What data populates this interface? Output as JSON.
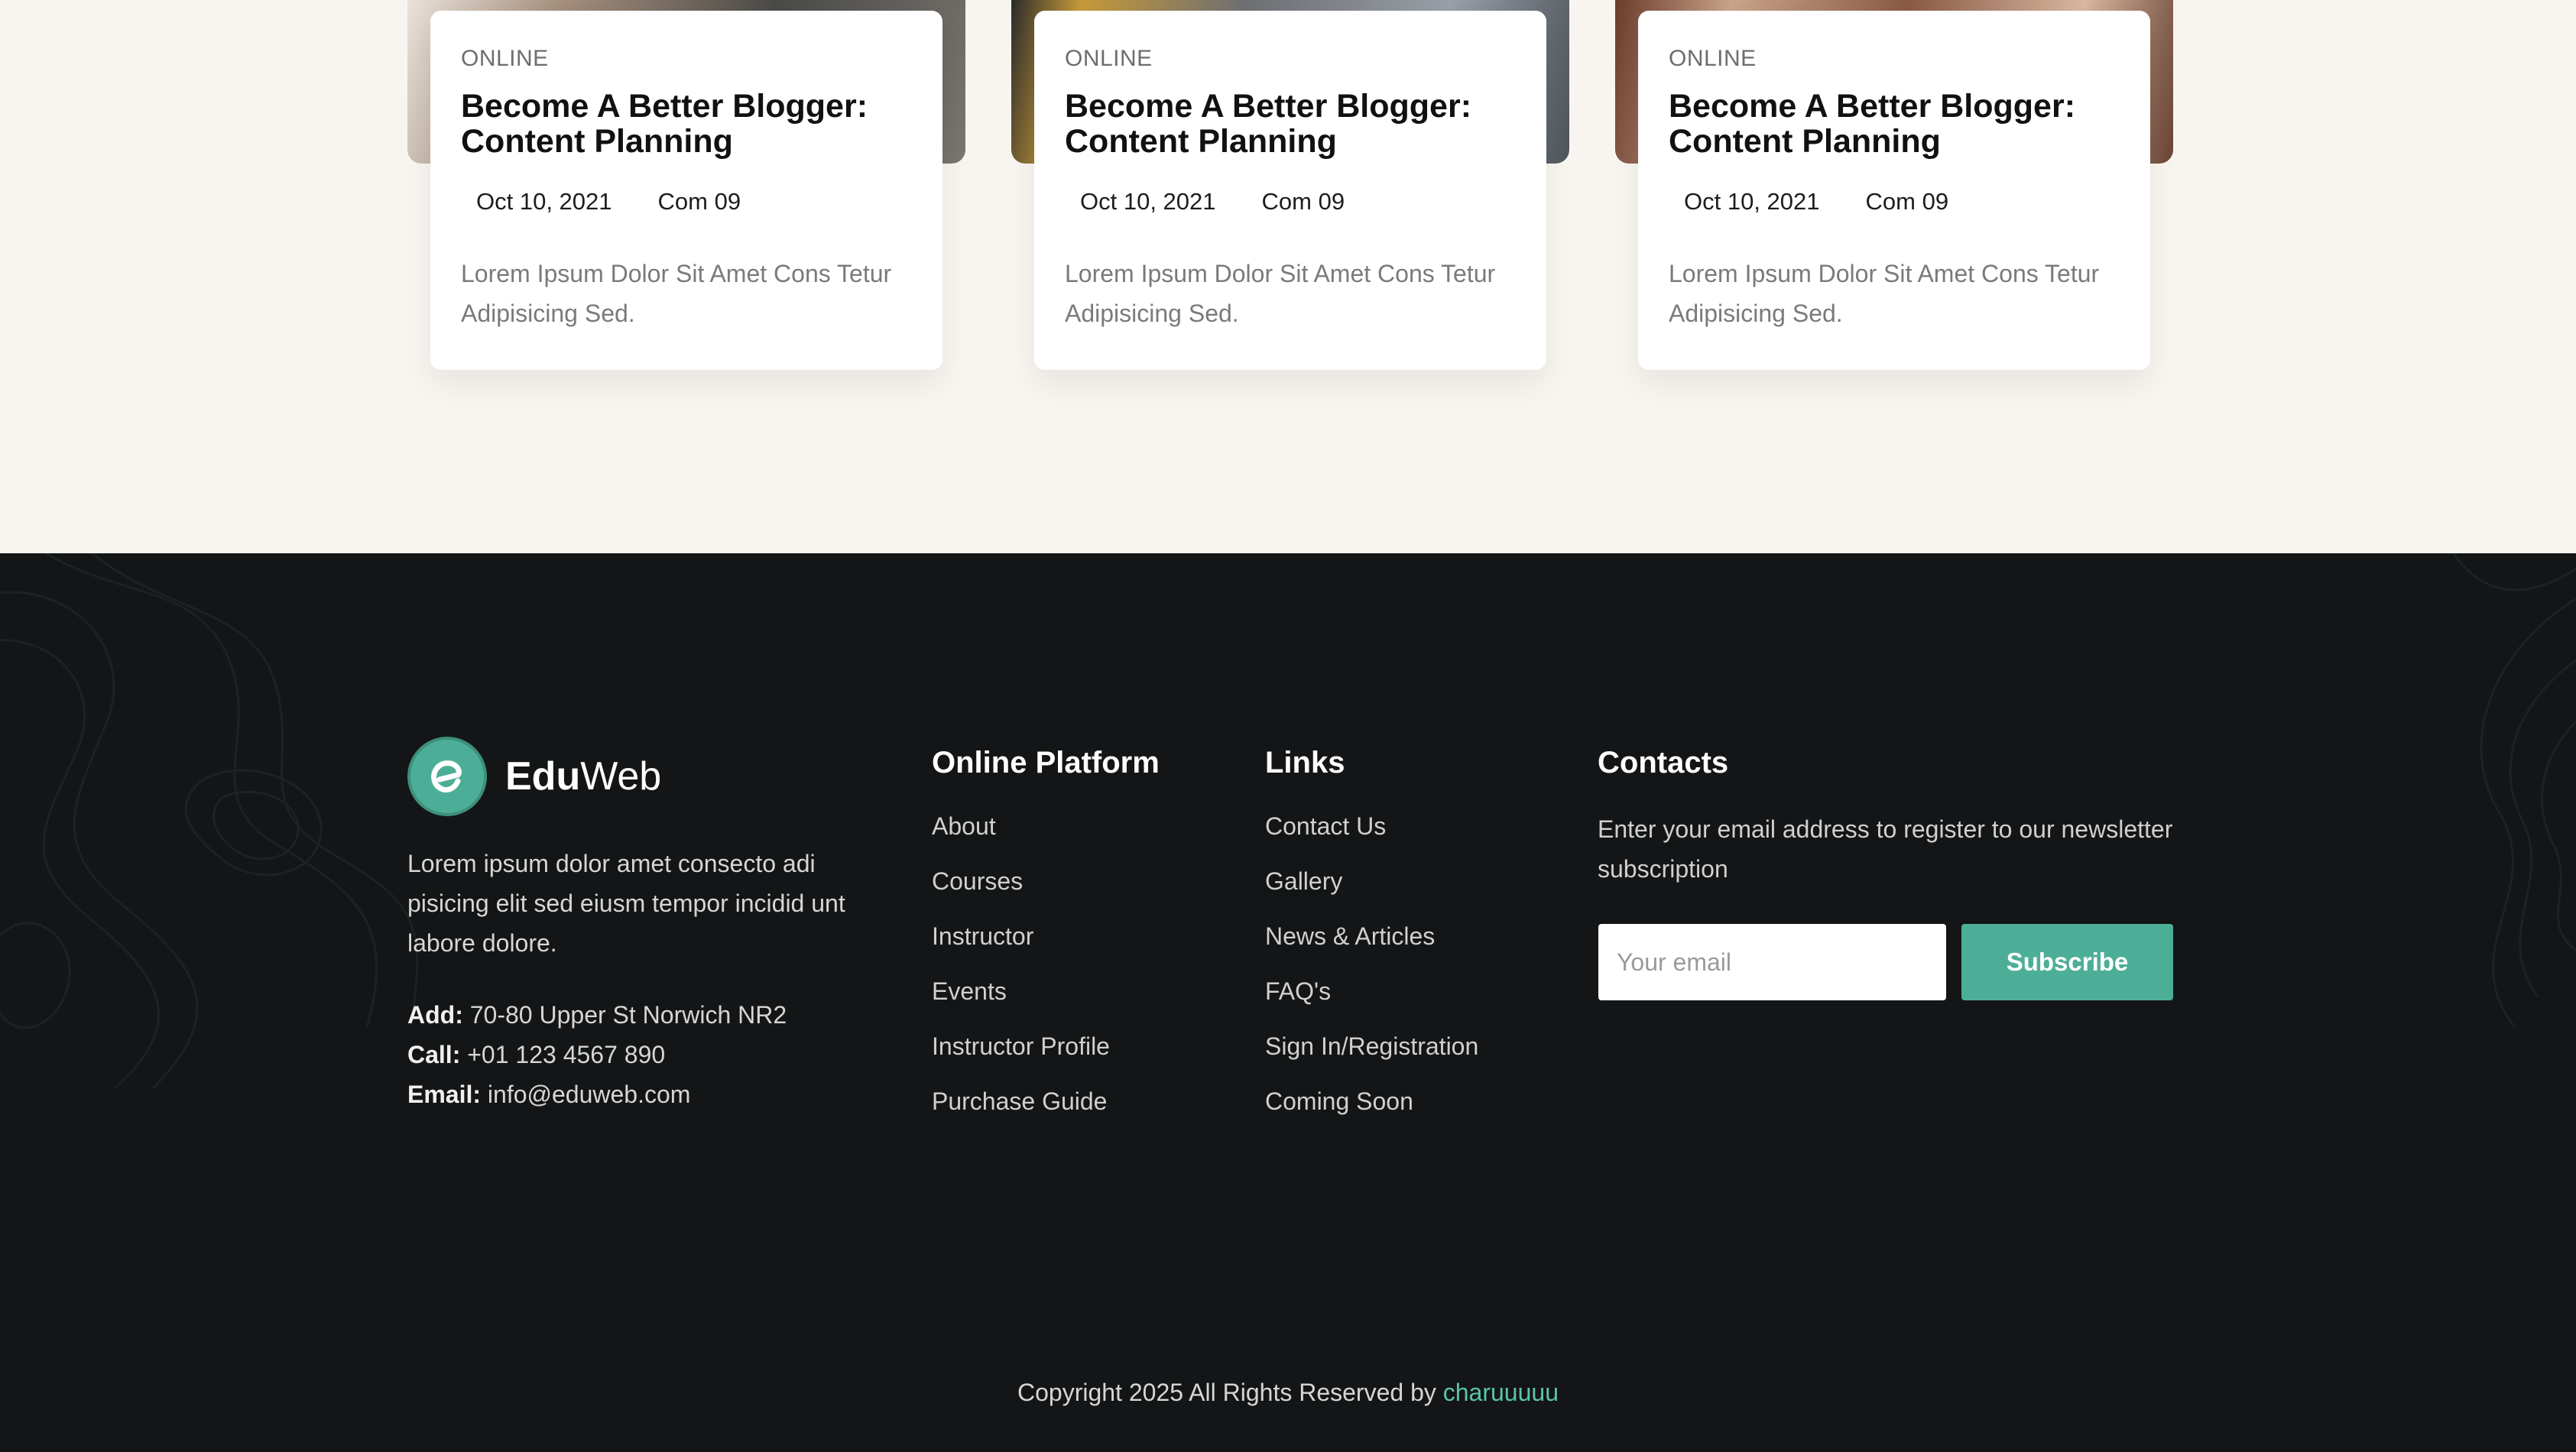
{
  "posts": [
    {
      "tag": "ONLINE",
      "title": "Become A Better Blogger: Content Planning",
      "date": "Oct 10, 2021",
      "comments": "Com 09",
      "excerpt": "Lorem Ipsum Dolor Sit Amet Cons Tetur Adipisicing Sed."
    },
    {
      "tag": "ONLINE",
      "title": "Become A Better Blogger: Content Planning",
      "date": "Oct 10, 2021",
      "comments": "Com 09",
      "excerpt": "Lorem Ipsum Dolor Sit Amet Cons Tetur Adipisicing Sed."
    },
    {
      "tag": "ONLINE",
      "title": "Become A Better Blogger: Content Planning",
      "date": "Oct 10, 2021",
      "comments": "Com 09",
      "excerpt": "Lorem Ipsum Dolor Sit Amet Cons Tetur Adipisicing Sed."
    }
  ],
  "footer": {
    "brand": {
      "bold": "Edu",
      "light": "Web",
      "icon": "e-logo-icon"
    },
    "about": "Lorem ipsum dolor amet consecto adi pisicing elit sed eiusm tempor incidid unt labore dolore.",
    "address_label": "Add:",
    "address": "70-80 Upper St Norwich NR2",
    "call_label": "Call:",
    "call": "+01 123 4567 890",
    "email_label": "Email:",
    "email": "info@eduweb.com",
    "online_platform": {
      "title": "Online Platform",
      "items": [
        "About",
        "Courses",
        "Instructor",
        "Events",
        "Instructor Profile",
        "Purchase Guide"
      ]
    },
    "links": {
      "title": "Links",
      "items": [
        "Contact Us",
        "Gallery",
        "News & Articles",
        "FAQ's",
        "Sign In/Registration",
        "Coming Soon"
      ]
    },
    "contacts": {
      "title": "Contacts",
      "text": "Enter your email address to register to our newsletter subscription",
      "placeholder": "Your email",
      "button": "Subscribe"
    },
    "copyright": "Copyright 2025 All Rights Reserved by",
    "author": "charuuuuu"
  },
  "colors": {
    "accent": "#4dae97",
    "footer_bg": "#131516",
    "page_bg": "#f8f5f0"
  }
}
